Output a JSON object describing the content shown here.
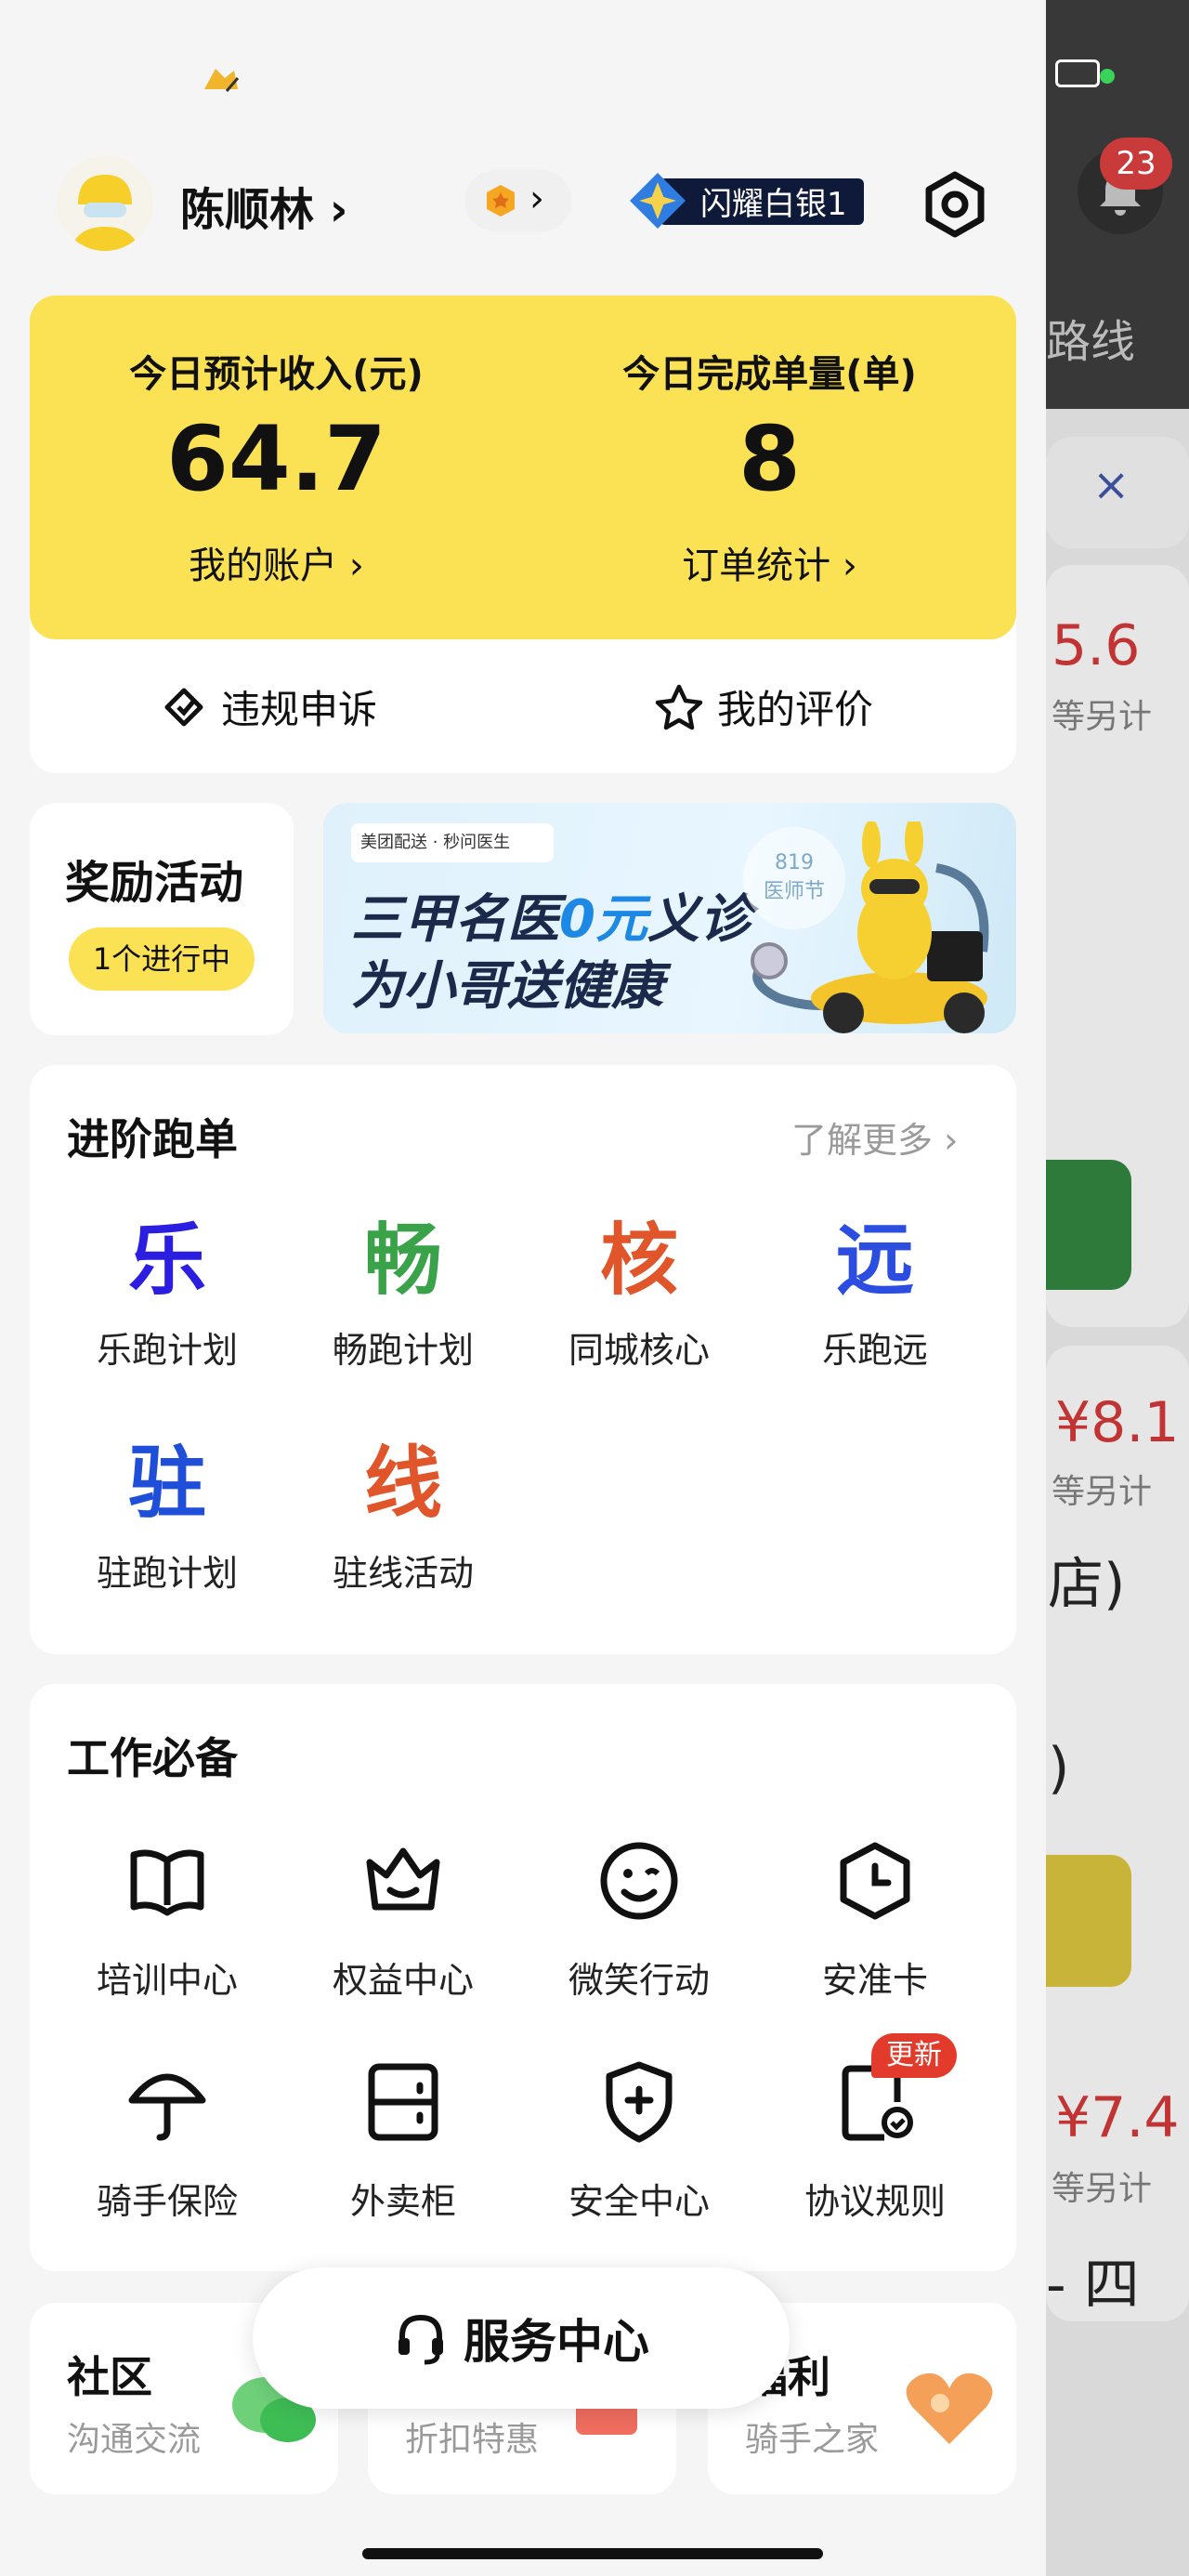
{
  "colors": {
    "accent_yellow": "#fbe255",
    "le": "#2b1ee0",
    "chang": "#3aa34a",
    "he": "#e0562a",
    "yuan": "#2b4de0",
    "zhu": "#1f4fd8",
    "xian": "#e0562a",
    "badge_bg": "#0f1a3a",
    "update_red": "#e23b2b"
  },
  "under": {
    "notif_count": "23",
    "route": "路线",
    "close": "×",
    "amount1": "5.6",
    "note1": "等另计",
    "amount2": "¥8.1",
    "note2": "等另计",
    "shop": "店)",
    "paren": ")",
    "amount3": "¥7.4",
    "note3": "等另计",
    "day": "- 四"
  },
  "header": {
    "name": "陈顺林 ›",
    "level_arrow": "›",
    "badge": "闪耀白银1"
  },
  "income": {
    "label": "今日预计收入(元)",
    "value": "64.7",
    "link": "我的账户 ›"
  },
  "orders": {
    "label": "今日完成单量(单)",
    "value": "8",
    "link": "订单统计 ›"
  },
  "actions": {
    "appeal": "违规申诉",
    "rating": "我的评价"
  },
  "rewards": {
    "title": "奖励活动",
    "status": "1个进行中"
  },
  "promo": {
    "chip": "美团配送 · 秒问医生",
    "line1a": "三甲名医",
    "line1b": "0元",
    "line1c": "义诊",
    "line2": "为小哥送健康",
    "tag1": "819",
    "tag2": "医师节"
  },
  "advanced": {
    "title": "进阶跑单",
    "more": "了解更多 ›",
    "items": [
      {
        "glyph": "乐",
        "label": "乐跑计划"
      },
      {
        "glyph": "畅",
        "label": "畅跑计划"
      },
      {
        "glyph": "核",
        "label": "同城核心"
      },
      {
        "glyph": "远",
        "label": "乐跑远"
      },
      {
        "glyph": "驻",
        "label": "驻跑计划"
      },
      {
        "glyph": "线",
        "label": "驻线活动"
      }
    ]
  },
  "work": {
    "title": "工作必备",
    "items": [
      {
        "icon": "book-icon",
        "label": "培训中心"
      },
      {
        "icon": "crown-icon",
        "label": "权益中心"
      },
      {
        "icon": "smile-icon",
        "label": "微笑行动"
      },
      {
        "icon": "clock-shield-icon",
        "label": "安准卡"
      },
      {
        "icon": "umbrella-icon",
        "label": "骑手保险"
      },
      {
        "icon": "locker-icon",
        "label": "外卖柜"
      },
      {
        "icon": "shield-plus-icon",
        "label": "安全中心"
      },
      {
        "icon": "document-check-icon",
        "label": "协议规则"
      }
    ],
    "update_badge": "更新"
  },
  "service": {
    "label": "服务中心"
  },
  "bottom": [
    {
      "title": "社区",
      "sub": "沟通交流"
    },
    {
      "title": "",
      "sub": "折扣特惠"
    },
    {
      "title": "福利",
      "sub": "骑手之家"
    }
  ]
}
